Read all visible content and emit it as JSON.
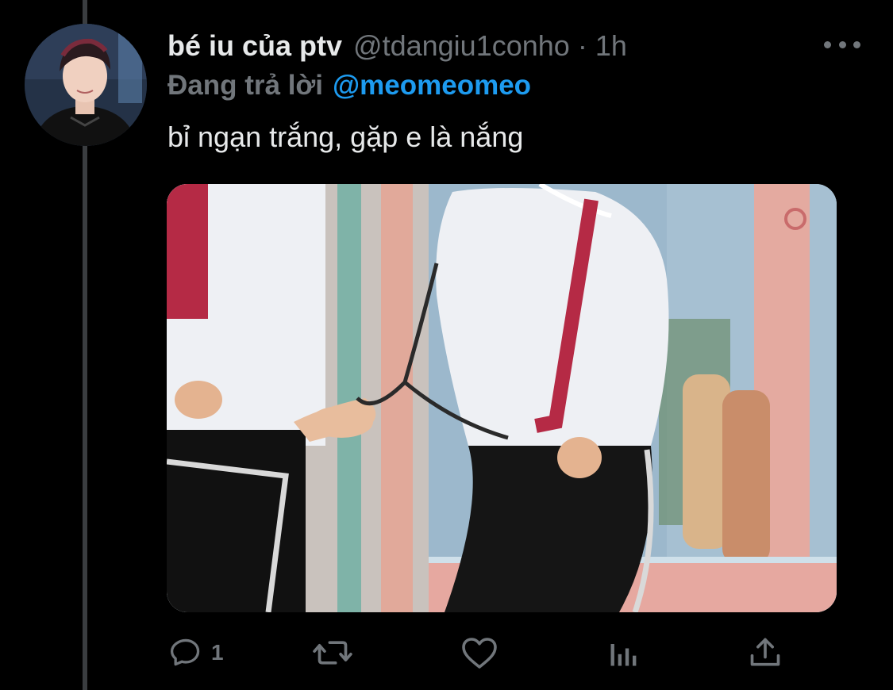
{
  "tweet": {
    "display_name": "bé iu của ptv",
    "handle": "@tdangiu1conho",
    "separator": "·",
    "time": "1h",
    "reply_prefix": "Đang trả lời",
    "reply_to": "@meomeomeo",
    "text": "bỉ ngạn trắng, gặp e là nắng"
  },
  "actions": {
    "reply_count": "1",
    "retweet_count": "",
    "like_count": ""
  },
  "icons": {
    "more": "more-icon",
    "reply": "reply-icon",
    "retweet": "retweet-icon",
    "like": "heart-icon",
    "analytics": "analytics-icon",
    "share": "share-icon"
  },
  "colors": {
    "background": "#000000",
    "text_primary": "#e7e9ea",
    "text_secondary": "#71767b",
    "accent": "#1d9bf0",
    "thread_line": "#3a3d40"
  }
}
